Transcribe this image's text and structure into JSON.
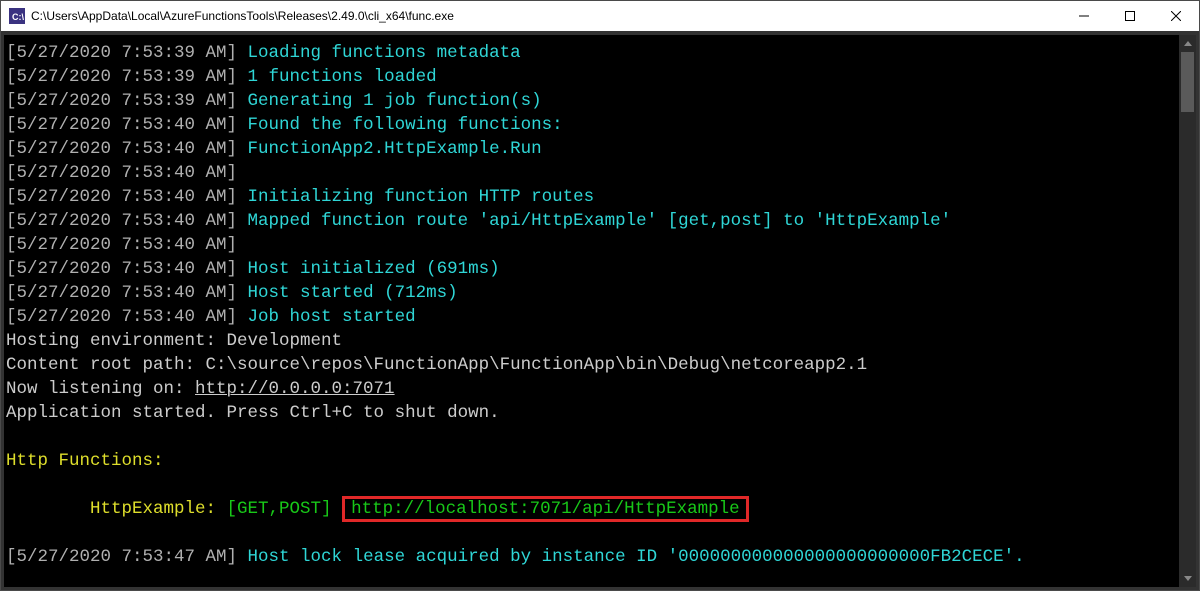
{
  "window": {
    "title": "C:\\Users\\AppData\\Local\\AzureFunctionsTools\\Releases\\2.49.0\\cli_x64\\func.exe"
  },
  "lines": [
    {
      "ts": "[5/27/2020 7:53:39 AM]",
      "msg": "Loading functions metadata",
      "cls": "info"
    },
    {
      "ts": "[5/27/2020 7:53:39 AM]",
      "msg": "1 functions loaded",
      "cls": "info"
    },
    {
      "ts": "[5/27/2020 7:53:39 AM]",
      "msg": "Generating 1 job function(s)",
      "cls": "info"
    },
    {
      "ts": "[5/27/2020 7:53:40 AM]",
      "msg": "Found the following functions:",
      "cls": "info"
    },
    {
      "ts": "[5/27/2020 7:53:40 AM]",
      "msg": "FunctionApp2.HttpExample.Run",
      "cls": "info"
    },
    {
      "ts": "[5/27/2020 7:53:40 AM]",
      "msg": "",
      "cls": "info"
    },
    {
      "ts": "[5/27/2020 7:53:40 AM]",
      "msg": "Initializing function HTTP routes",
      "cls": "info"
    },
    {
      "ts": "[5/27/2020 7:53:40 AM]",
      "msg": "Mapped function route 'api/HttpExample' [get,post] to 'HttpExample'",
      "cls": "info"
    },
    {
      "ts": "[5/27/2020 7:53:40 AM]",
      "msg": "",
      "cls": "info"
    },
    {
      "ts": "[5/27/2020 7:53:40 AM]",
      "msg": "Host initialized (691ms)",
      "cls": "info"
    },
    {
      "ts": "[5/27/2020 7:53:40 AM]",
      "msg": "Host started (712ms)",
      "cls": "info"
    },
    {
      "ts": "[5/27/2020 7:53:40 AM]",
      "msg": "Job host started",
      "cls": "info"
    }
  ],
  "static_lines": [
    "Hosting environment: Development",
    "Content root path: C:\\source\\repos\\FunctionApp\\FunctionApp\\bin\\Debug\\netcoreapp2.1",
    "Now listening on: http://0.0.0.0:7071",
    "Application started. Press Ctrl+C to shut down."
  ],
  "http_functions": {
    "header": "Http Functions:",
    "indent": "        ",
    "name_label": "HttpExample: ",
    "verbs": "[GET,POST] ",
    "url": "http://localhost:7071/api/HttpExample"
  },
  "final": {
    "ts": "[5/27/2020 7:53:47 AM]",
    "msg": "Host lock lease acquired by instance ID '000000000000000000000000FB2CECE'."
  }
}
